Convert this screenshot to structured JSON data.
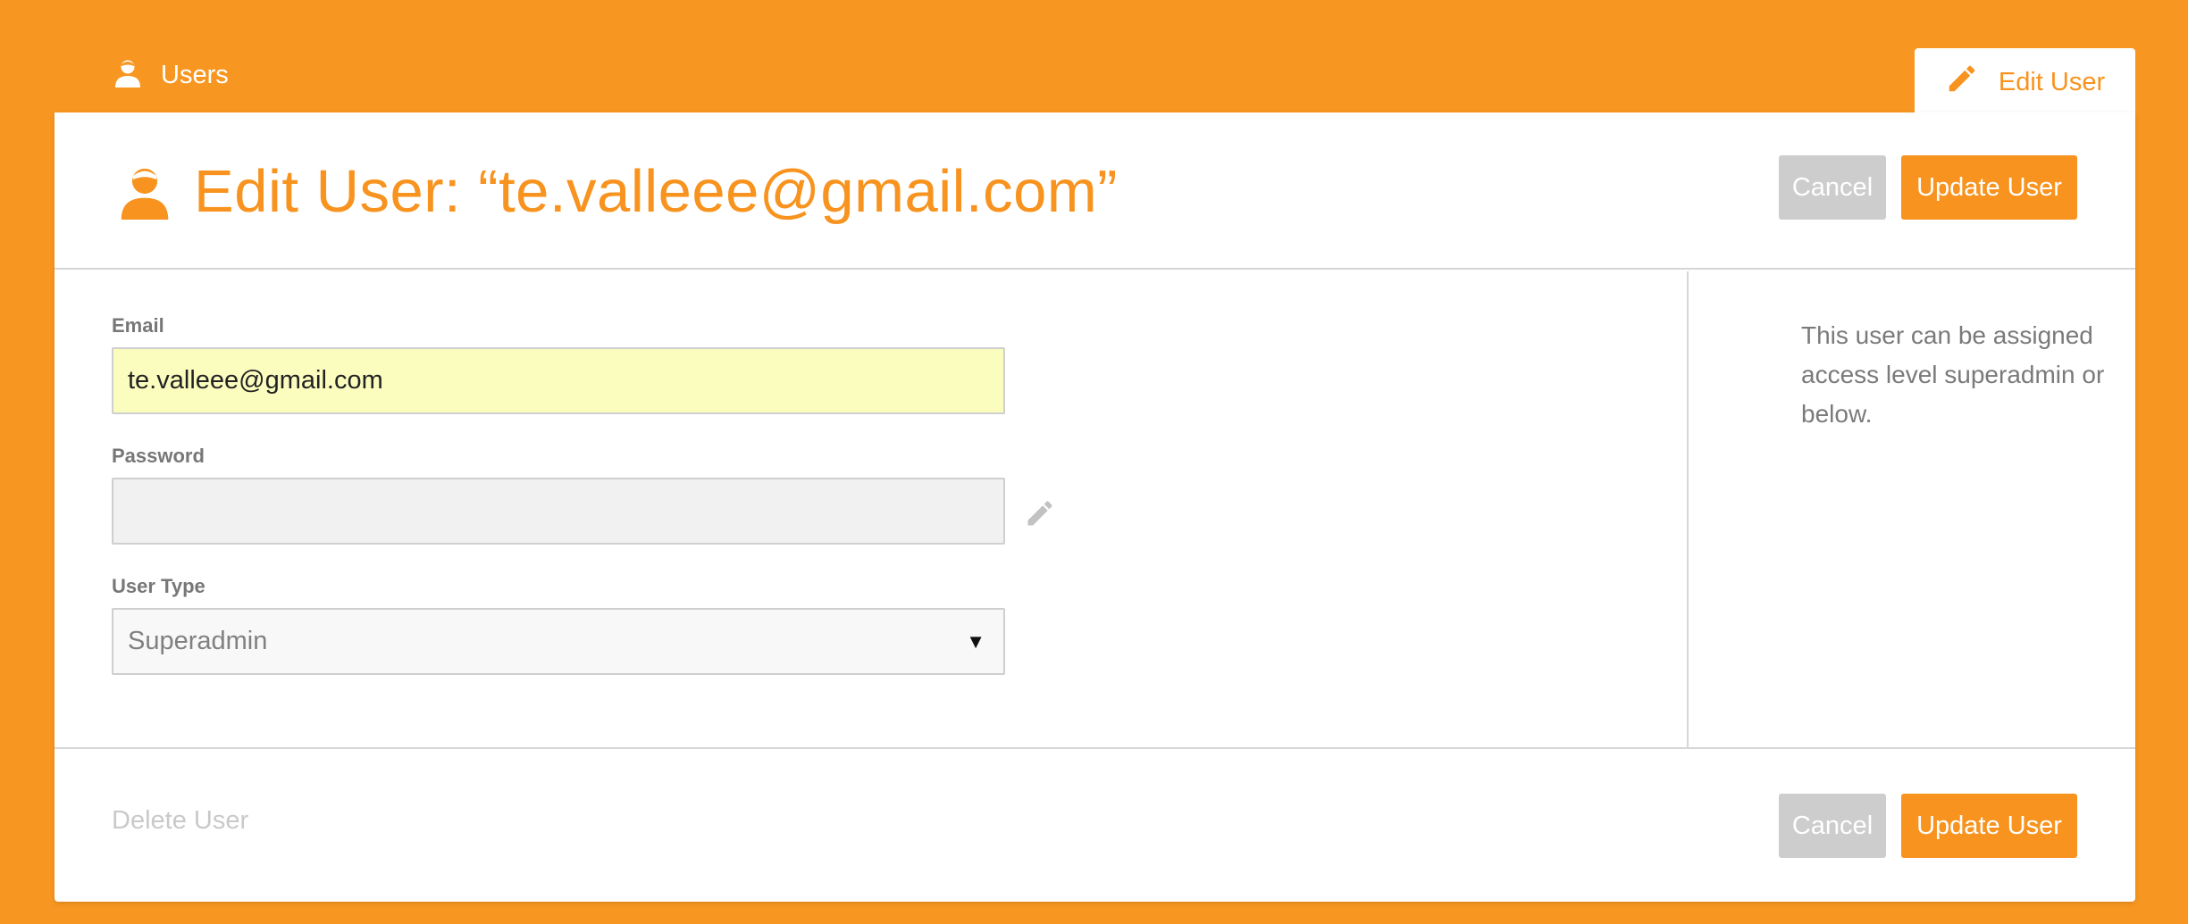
{
  "nav": {
    "users_label": "Users",
    "active_tab_label": "Edit User"
  },
  "header": {
    "title": "Edit User: “te.valleee@gmail.com”",
    "cancel_label": "Cancel",
    "update_label": "Update User"
  },
  "form": {
    "email": {
      "label": "Email",
      "value": "te.valleee@gmail.com"
    },
    "password": {
      "label": "Password",
      "value": ""
    },
    "user_type": {
      "label": "User Type",
      "selected": "Superadmin"
    }
  },
  "sidebar": {
    "help_text": "This user can be assigned access level superadmin or below."
  },
  "footer": {
    "delete_label": "Delete User",
    "cancel_label": "Cancel",
    "update_label": "Update User"
  },
  "icons": {
    "user": "user-icon",
    "pencil": "pencil-icon",
    "caret": "caret-down-icon"
  },
  "colors": {
    "brand": "#f7931e",
    "cancel": "#cdcdcd",
    "email_highlight": "#fbfdbf"
  }
}
